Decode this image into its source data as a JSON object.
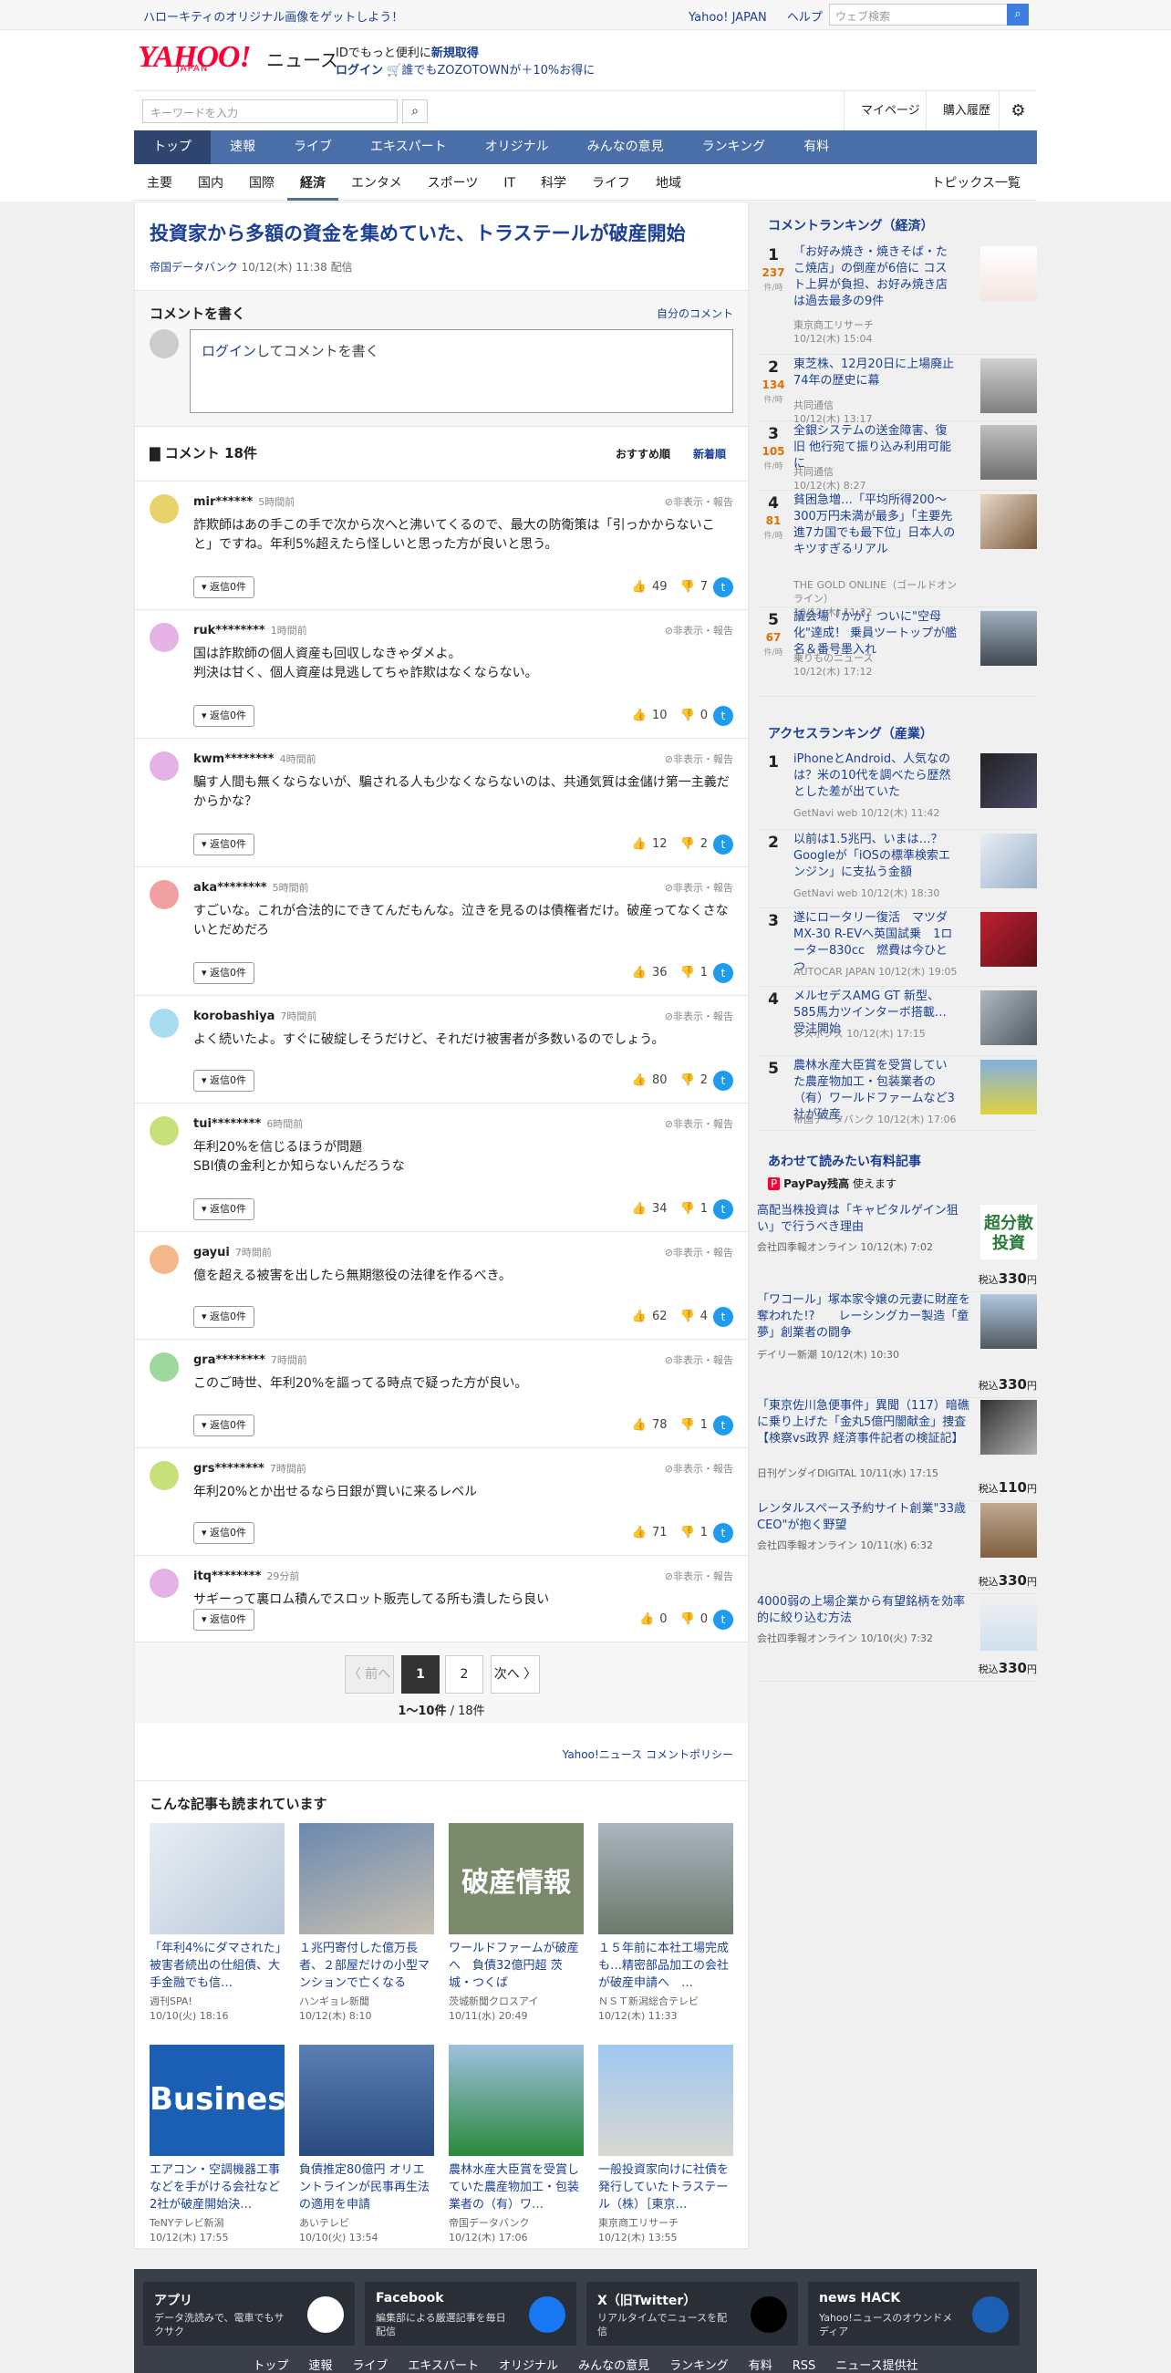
{
  "header": {
    "promo": "ハローキティのオリジナル画像をゲットしよう！",
    "links": [
      "Yahoo! JAPAN",
      "ヘルプ"
    ],
    "websearch_placeholder": "ウェブ検索",
    "logo": "YAHOO!",
    "logo_sub": "JAPAN",
    "logo_news": "ニュース",
    "id_text": "IDでもっと便利に",
    "id_link": "新規取得",
    "login": "ログイン",
    "zozo": "誰でもZOZOTOWNが＋10%お得に",
    "keyword_placeholder": "キーワードを入力",
    "mypage": "マイページ",
    "history": "購入履歴"
  },
  "mainnav": [
    "トップ",
    "速報",
    "ライブ",
    "エキスパート",
    "オリジナル",
    "みんなの意見",
    "ランキング",
    "有料"
  ],
  "subnav": [
    "主要",
    "国内",
    "国際",
    "経済",
    "エンタメ",
    "スポーツ",
    "IT",
    "科学",
    "ライフ",
    "地域"
  ],
  "subnav_topics": "トピックス一覧",
  "article": {
    "title": "投資家から多額の資金を集めていた、トラステールが破産開始",
    "source": "帝国データバンク",
    "date": "10/12(木) 11:38",
    "delivery": "配信"
  },
  "comment_write": {
    "title": "コメントを書く",
    "mine": "自分のコメント",
    "login": "ログイン",
    "placeholder": "してコメントを書く"
  },
  "comments_head": "コメント 18件",
  "sort": [
    "おすすめ順",
    "新着順"
  ],
  "hide_label": "非表示・報告",
  "reply_label": "返信0件",
  "comments": [
    {
      "user": "mir******",
      "time": "5時間前",
      "body": "詐欺師はあの手この手で次から次へと沸いてくるので、最大の防衛策は「引っかからないこと」ですね。年利5%超えたら怪しいと思った方が良いと思う。",
      "up": "49",
      "down": "7",
      "color": "#e8d36a"
    },
    {
      "user": "ruk********",
      "time": "1時間前",
      "body": "国は詐欺師の個人資産も回収しなきゃダメよ。\n判決は甘く、個人資産は見逃してちゃ詐欺はなくならない。",
      "up": "10",
      "down": "0",
      "color": "#e5b3e5"
    },
    {
      "user": "kwm********",
      "time": "4時間前",
      "body": "騙す人間も無くならないが、騙される人も少なくならないのは、共通気質は金儲け第一主義だからかな？",
      "up": "12",
      "down": "2",
      "color": "#e5b3e5"
    },
    {
      "user": "aka********",
      "time": "5時間前",
      "body": "すごいな。これが合法的にできてんだもんな。泣きを見るのは債権者だけ。破産ってなくさないとだめだろ",
      "up": "36",
      "down": "1",
      "color": "#f0a0a0"
    },
    {
      "user": "korobashiya",
      "time": "7時間前",
      "body": "よく続いたよ。すぐに破綻しそうだけど、それだけ被害者が多数いるのでしょう。",
      "up": "80",
      "down": "2",
      "color": "#a8dcf0"
    },
    {
      "user": "tui********",
      "time": "6時間前",
      "body": "年利20%を信じるほうが問題\nSBI債の金利とか知らないんだろうな",
      "up": "34",
      "down": "1",
      "color": "#c8e07a"
    },
    {
      "user": "gayui",
      "time": "7時間前",
      "body": "億を超える被害を出したら無期懲役の法律を作るべき。",
      "up": "62",
      "down": "4",
      "color": "#f5b88a"
    },
    {
      "user": "gra********",
      "time": "7時間前",
      "body": "このご時世、年利20%を謳ってる時点で疑った方が良い。",
      "up": "78",
      "down": "1",
      "color": "#9ed89e"
    },
    {
      "user": "grs********",
      "time": "7時間前",
      "body": "年利20%とか出せるなら日銀が買いに来るレベル",
      "up": "71",
      "down": "1",
      "color": "#c8e07a"
    },
    {
      "user": "itq********",
      "time": "29分前",
      "body": "サギーって裏ロム積んでスロット販売してる所も潰したら良い",
      "up": "0",
      "down": "0",
      "color": "#e5b3e5"
    }
  ],
  "pager": {
    "prev": "〈 前へ",
    "current": "1",
    "p2": "2",
    "next": "次へ 〉",
    "count_bold": "1〜10件",
    "count_total": "/ 18件"
  },
  "policy": "Yahoo!ニュース コメントポリシー",
  "also": {
    "title": "こんな記事も読まれています",
    "cards": [
      {
        "title": "「年利4%にダマされた」被害者続出の仕組債、大手金融でも信…",
        "source": "週刊SPA!",
        "date": "10/10(火) 18:16"
      },
      {
        "title": "１兆円寄付した億万長者、２部屋だけの小型マンションで亡くなる",
        "source": "ハンギョレ新聞",
        "date": "10/12(木) 8:10"
      },
      {
        "title": "ワールドファームが破産へ　負債32億円超 茨城・つくば",
        "source": "茨城新聞クロスアイ",
        "date": "10/11(水) 20:49",
        "img_text": "破産情報"
      },
      {
        "title": "１５年前に本社工場完成も…精密部品加工の会社が破産申請へ　…",
        "source": "ＮＳＴ新潟総合テレビ",
        "date": "10/12(木) 11:33"
      },
      {
        "title": "エアコン・空調機器工事などを手がける会社など2社が破産開始決…",
        "source": "TeNYテレビ新潟",
        "date": "10/12(木) 17:55",
        "img_text": "Business"
      },
      {
        "title": "負債推定80億円 オリエントラインが民事再生法の適用を申請",
        "source": "あいテレビ",
        "date": "10/10(火) 13:54"
      },
      {
        "title": "農林水産大臣賞を受賞していた農産物加工・包装業者の（有）ワ…",
        "source": "帝国データバンク",
        "date": "10/12(木) 17:06"
      },
      {
        "title": "一般投資家向けに社債を発行していたトラステール（株）［東京…",
        "source": "東京商工リサーチ",
        "date": "10/12(木) 13:55"
      }
    ]
  },
  "side": {
    "comment_rank_title": "コメントランキング（経済）",
    "count_unit": "件/時",
    "comment_rank": [
      {
        "num": "1",
        "count": "237",
        "title": "「お好み焼き・焼きそば・たこ焼店」の倒産が6倍に コスト上昇が負担、お好み焼き店は過去最多の9件",
        "source": "東京商工リサーチ",
        "date": "10/12(木) 15:04"
      },
      {
        "num": "2",
        "count": "134",
        "title": "東芝株、12月20日に上場廃止 74年の歴史に幕",
        "source": "共同通信",
        "date": "10/12(木) 13:17"
      },
      {
        "num": "3",
        "count": "105",
        "title": "全銀システムの送金障害、復旧 他行宛て振り込み利用可能に",
        "source": "共同通信",
        "date": "10/12(木) 8:27"
      },
      {
        "num": "4",
        "count": "81",
        "title": "貧困急増…「平均所得200〜300万円未満が最多」「主要先進7カ国でも最下位」日本人のキツすぎるリアル",
        "source": "THE GOLD ONLINE（ゴールドオンライン）",
        "date": "10/12(木) 11:32"
      },
      {
        "num": "5",
        "count": "67",
        "title": "議会場「かが」ついに\"空母化\"達成！ 乗員ツートップが艦名＆番号墨入れ",
        "source": "乗りものニュース",
        "date": "10/12(木) 17:12"
      }
    ],
    "access_rank_title": "アクセスランキング（産業）",
    "access_rank": [
      {
        "num": "1",
        "title": "iPhoneとAndroid、人気なのは？米の10代を調べたら歴然とした差が出ていた",
        "source": "GetNavi web",
        "date": "10/12(木) 11:42"
      },
      {
        "num": "2",
        "title": "以前は1.5兆円、いまは…？ Googleが「iOSの標準検索エンジン」に支払う金額",
        "source": "GetNavi web",
        "date": "10/12(木) 18:30"
      },
      {
        "num": "3",
        "title": "遂にロータリー復活　マツダMX-30 R-EVへ英国試乗　1ローター830cc　燃費は今ひとつ",
        "source": "AUTOCAR JAPAN",
        "date": "10/12(木) 19:05"
      },
      {
        "num": "4",
        "title": "メルセデスAMG GT 新型、585馬力ツインターボ搭載…受注開始",
        "source": "レスポンス",
        "date": "10/12(木) 17:15"
      },
      {
        "num": "5",
        "title": "農林水産大臣賞を受賞していた農産物加工・包装業者の（有）ワールドファームなど3社が破産",
        "source": "帝国データバンク",
        "date": "10/12(木) 17:06"
      }
    ],
    "paid_title": "あわせて読みたい有料記事",
    "paid_pay": "PayPay残高",
    "paid_pay_suffix": "使えます",
    "tax": "税込",
    "yen": "円",
    "paid": [
      {
        "title": "高配当株投資は「キャピタルゲイン狙い」で行うべき理由",
        "source": "会社四季報オンライン",
        "date": "10/12(木) 7:02",
        "price": "330",
        "img_text": "超分散投資"
      },
      {
        "title": "「ワコール」塚本家令嬢の元妻に財産を奪われた!?　　レーシングカー製造「童夢」創業者の闘争",
        "source": "デイリー新潮",
        "date": "10/12(木) 10:30",
        "price": "330"
      },
      {
        "title": "「東京佐川急便事件」異聞（117）暗礁に乗り上げた「金丸5億円闇献金」捜査【検察vs政界 経済事件記者の検証記】",
        "source": "日刊ゲンダイDIGITAL",
        "date": "10/11(水) 17:15",
        "price": "110"
      },
      {
        "title": "レンタルスペース予約サイト創業\"33歳CEO\"が抱く野望",
        "source": "会社四季報オンライン",
        "date": "10/11(水) 6:32",
        "price": "330"
      },
      {
        "title": "4000弱の上場企業から有望銘柄を効率的に絞り込む方法",
        "source": "会社四季報オンライン",
        "date": "10/10(火) 7:32",
        "price": "330"
      }
    ]
  },
  "footer": {
    "boxes": [
      {
        "head": "アプリ",
        "desc": "データ洗読みで、電車でもサクサク"
      },
      {
        "head": "Facebook",
        "desc": "編集部による厳選記事を毎日配信"
      },
      {
        "head": "X（旧Twitter）",
        "desc": "リアルタイムでニュースを配信"
      },
      {
        "head": "news HACK",
        "desc": "Yahoo!ニュースのオウンドメディア"
      }
    ],
    "links": [
      "トップ",
      "速報",
      "ライブ",
      "エキスパート",
      "オリジナル",
      "みんなの意見",
      "ランキング",
      "有料",
      "RSS",
      "ニュース提供社"
    ]
  }
}
